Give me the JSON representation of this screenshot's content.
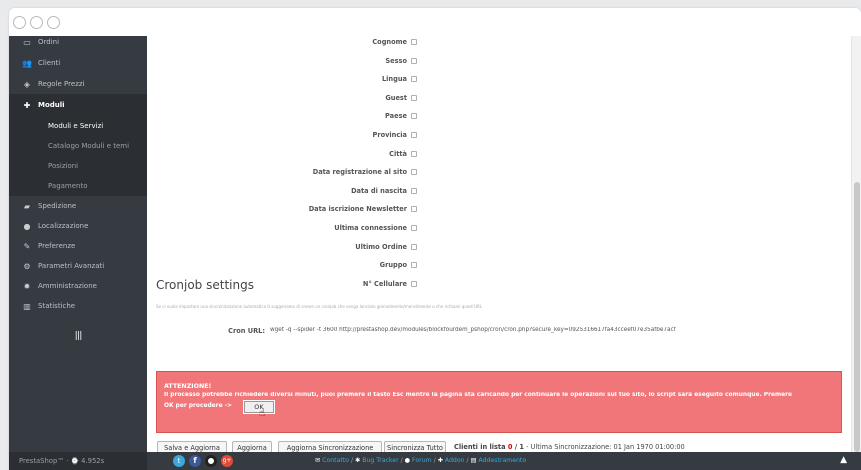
{
  "sidebar": {
    "items": [
      {
        "label": "Ordini",
        "icon": "credit-card-icon",
        "glyph": "▭"
      },
      {
        "label": "Clienti",
        "icon": "users-icon",
        "glyph": "👥"
      },
      {
        "label": "Regole Prezzi",
        "icon": "tag-icon",
        "glyph": "◈"
      },
      {
        "label": "Moduli",
        "icon": "puzzle-icon",
        "glyph": "✚"
      }
    ],
    "sub_items": [
      {
        "label": "Moduli e Servizi"
      },
      {
        "label": "Catalogo Moduli e temi"
      },
      {
        "label": "Posizioni"
      },
      {
        "label": "Pagamento"
      }
    ],
    "items2": [
      {
        "label": "Spedizione",
        "icon": "truck-icon",
        "glyph": "▰"
      },
      {
        "label": "Localizzazione",
        "icon": "globe-icon",
        "glyph": "●"
      },
      {
        "label": "Preferenze",
        "icon": "wrench-icon",
        "glyph": "✎"
      },
      {
        "label": "Parametri Avanzati",
        "icon": "cogs-icon",
        "glyph": "⚙"
      },
      {
        "label": "Amministrazione",
        "icon": "gear-icon",
        "glyph": "✹"
      },
      {
        "label": "Statistiche",
        "icon": "bar-chart-icon",
        "glyph": "▥"
      }
    ],
    "collapse_glyph": "|||",
    "footer": "PrestaShop™ · ⌚ 4.952s"
  },
  "fields": [
    "Cognome",
    "Sesso",
    "Lingua",
    "Guest",
    "Paese",
    "Provincia",
    "Città",
    "Data registrazione al sito",
    "Data di nascita",
    "Data iscrizione Newsletter",
    "Ultima connessione",
    "Ultimo Ordine",
    "Gruppo",
    "N° Cellulare"
  ],
  "cron": {
    "title": "Cronjob settings",
    "help": "Se ci vuole impostare una sincronizzazione automatica ti suggeriamo di creare un cronjob che venga lanciato giornalmente/mensilmente o che richiami quest'URL",
    "label": "Cron URL:",
    "url": "wget -q --spider -t 3600 http://prestashop.dev/modules/blockfourdem_pshop/cron/cron.php?secure_key=0925316617fa43cceef07e35afbe7acf"
  },
  "alert": {
    "title": "ATTENZIONE!",
    "message": "Il processo potrebbe richiedere diversi minuti, puoi premere il tasto Esc mentre la pagina sta caricando per continuare le operazioni sul tuo sito, lo script sarà eseguito comunque. Premere",
    "message2": "OK per procedere ->",
    "ok_label": "OK"
  },
  "actions": {
    "save_update": "Salva e Aggiorna",
    "update": "Aggiorna",
    "update_sync": "Aggiorna Sincronizzazione",
    "sync_all": "Sincronizza Tutto",
    "status_prefix": "Clienti in lista ",
    "status_count": "0",
    "status_total": " / 1",
    "status_suffix": " - Ultima Sincronizzazione: 01 Jan 1970 01:00:00"
  },
  "footer_links": {
    "contact": "Contatto",
    "bug": "Bug Tracker",
    "forum": "Forum",
    "addon": "Addon",
    "training": "Addestramento"
  },
  "colors": {
    "sidebar_bg": "#363a41",
    "alert_bg": "#f17679",
    "alert_border": "#d9534f",
    "accent_red": "#e00000"
  }
}
